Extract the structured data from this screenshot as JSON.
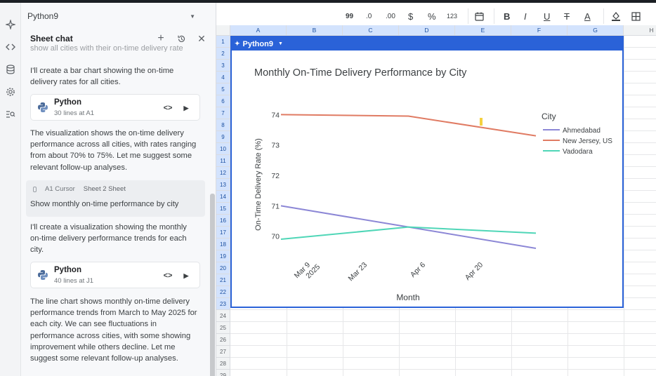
{
  "sheet_selector": {
    "value": "Python9"
  },
  "chat": {
    "title": "Sheet chat",
    "truncated_text": "show all cities with their on-time delivery rate",
    "messages": [
      {
        "lines": [
          "I'll create a bar chart showing the on-time",
          "delivery rates for all cities."
        ]
      },
      {
        "lines": [
          "The visualization shows the on-time delivery",
          "performance across all cities, with rates ranging",
          "from about 70% to 75%. Let me suggest some",
          "relevant follow-up analyses."
        ]
      },
      {
        "lines": [
          "I'll create a visualization showing the monthly",
          "on-time delivery performance trends for each",
          "city."
        ]
      },
      {
        "lines": [
          "The line chart shows monthly on-time delivery",
          "performance trends from March to May 2025 for",
          "each city. We can see fluctuations in",
          "performance across cities, with some showing",
          "improvement while others decline. Let me",
          "suggest some relevant follow-up analyses."
        ]
      }
    ],
    "code_cards": [
      {
        "name": "Python",
        "sub": "30 lines at A1"
      },
      {
        "name": "Python",
        "sub": "40 lines at J1"
      }
    ],
    "user_message": {
      "cursor_label": "A1 Cursor",
      "sheet_label": "Sheet 2 Sheet",
      "text": "Show monthly on-time performance by city"
    }
  },
  "toolbar": {
    "quote": "99",
    "dec_decrease": ".0",
    "dec_increase": ".00",
    "currency": "$",
    "percent": "%",
    "number": "123",
    "bold": "B",
    "italic": "I",
    "underline": "U",
    "strike": "T",
    "text_color": "A"
  },
  "grid": {
    "columns": [
      "A",
      "B",
      "C",
      "D",
      "E",
      "F",
      "G",
      "H"
    ],
    "rows": [
      "1",
      "2",
      "3",
      "4",
      "5",
      "6",
      "7",
      "8",
      "9",
      "10",
      "11",
      "12",
      "13",
      "14",
      "15",
      "16",
      "17",
      "18",
      "19",
      "20",
      "21",
      "22",
      "23",
      "24",
      "25",
      "26",
      "27",
      "28",
      "29"
    ]
  },
  "chart_object": {
    "name": "Python9"
  },
  "colors": {
    "ahmedabad": "#8c87d6",
    "new_jersey": "#e07b63",
    "vadodara": "#4fd6b7",
    "selection": "#2a62d8"
  },
  "chart_data": {
    "type": "line",
    "title": "Monthly On-Time Delivery Performance by City",
    "xlabel": "Month",
    "ylabel": "On-Time Delivery Rate (%)",
    "legend_title": "City",
    "legend_position": "top-right",
    "grid": false,
    "x_ticks": [
      {
        "lines": [
          "Mar 9",
          "2025"
        ]
      },
      {
        "lines": [
          "Mar 23"
        ]
      },
      {
        "lines": [
          "Apr 6"
        ]
      },
      {
        "lines": [
          "Apr 20"
        ]
      }
    ],
    "y_ticks": [
      "74",
      "73",
      "72",
      "71",
      "70"
    ],
    "ylim": [
      69.6,
      74.1
    ],
    "x": [
      "2025-03-01",
      "2025-04-01",
      "2025-05-01"
    ],
    "series": [
      {
        "name": "Ahmedabad",
        "color": "#8c87d6",
        "values": [
          71.0,
          70.3,
          69.6
        ]
      },
      {
        "name": "New Jersey, US",
        "color": "#e07b63",
        "values": [
          74.0,
          73.95,
          73.3
        ]
      },
      {
        "name": "Vadodara",
        "color": "#4fd6b7",
        "values": [
          69.9,
          70.3,
          70.1
        ]
      }
    ]
  }
}
